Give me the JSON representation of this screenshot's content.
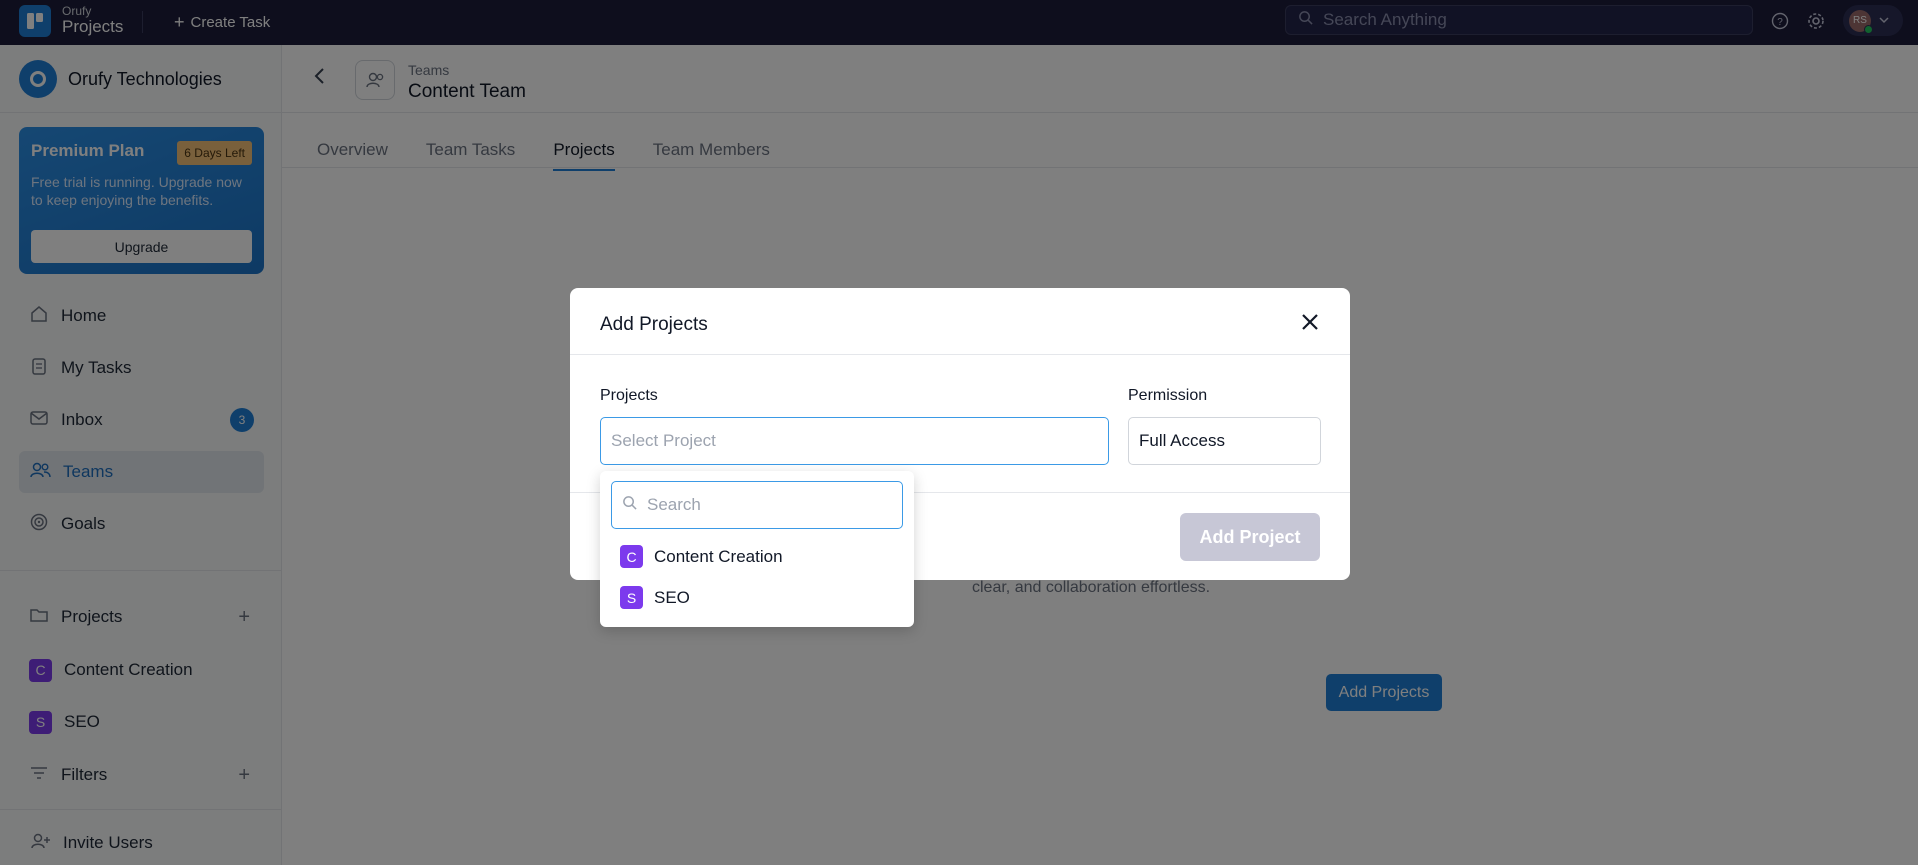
{
  "topbar": {
    "brand_small": "Orufy",
    "brand_big": "Projects",
    "create_task": "Create Task",
    "search_placeholder": "Search Anything",
    "avatar_initials": "RS"
  },
  "sidebar": {
    "org_name": "Orufy Technologies",
    "plan": {
      "title": "Premium Plan",
      "badge": "6 Days Left",
      "desc": "Free trial is running. Upgrade now to keep enjoying the benefits.",
      "button": "Upgrade"
    },
    "nav": [
      {
        "label": "Home"
      },
      {
        "label": "My Tasks"
      },
      {
        "label": "Inbox",
        "badge": "3"
      },
      {
        "label": "Teams"
      },
      {
        "label": "Goals"
      }
    ],
    "projects_label": "Projects",
    "projects": [
      {
        "letter": "C",
        "label": "Content Creation"
      },
      {
        "letter": "S",
        "label": "SEO"
      }
    ],
    "filters_label": "Filters",
    "invite_label": "Invite Users"
  },
  "main": {
    "crumb": "Teams",
    "title": "Content Team",
    "tabs": [
      "Overview",
      "Team Tasks",
      "Projects",
      "Team Members"
    ],
    "active_tab": "Projects",
    "empty_text": "clear, and collaboration effortless.",
    "empty_button": "Add Projects"
  },
  "modal": {
    "title": "Add Projects",
    "projects_label": "Projects",
    "projects_placeholder": "Select Project",
    "permission_label": "Permission",
    "permission_value": "Full Access",
    "submit": "Add Project"
  },
  "dropdown": {
    "search_placeholder": "Search",
    "items": [
      {
        "letter": "C",
        "label": "Content Creation"
      },
      {
        "letter": "S",
        "label": "SEO"
      }
    ]
  },
  "colors": {
    "accent": "#1e7fd6",
    "topbar": "#1c1d3a",
    "project_badge": "#7c3aed"
  }
}
